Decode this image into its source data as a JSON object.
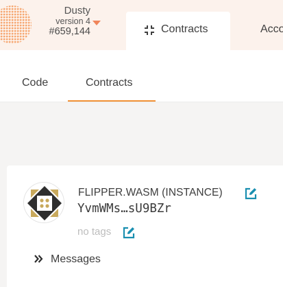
{
  "chain": {
    "name": "Dusty",
    "version": "version 4",
    "block": "#659,144"
  },
  "nav": {
    "active_tab": "Contracts",
    "next_tab": "Acco"
  },
  "subtabs": {
    "code": "Code",
    "contracts": "Contracts"
  },
  "contract": {
    "title": "FLIPPER.WASM (INSTANCE)",
    "address": "YvmWMs…sU9BZr",
    "tags": "no tags",
    "messages_label": "Messages"
  },
  "colors": {
    "accent": "#f19135",
    "edit_icon": "#1a8fb0",
    "header_bg": "#fcf2ec",
    "page_bg": "#f5f4f3"
  }
}
